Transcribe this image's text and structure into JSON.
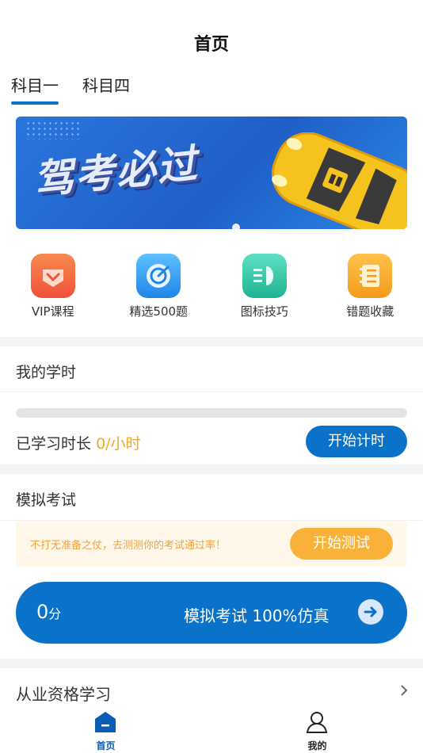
{
  "header": {
    "title": "首页"
  },
  "tabs": [
    {
      "label": "科目一",
      "active": true
    },
    {
      "label": "科目四",
      "active": false
    }
  ],
  "banner": {
    "slogan": "驾考必过"
  },
  "quick_actions": [
    {
      "label": "VIP课程",
      "icon": "vip-heart-icon",
      "color": "#f4683c"
    },
    {
      "label": "精选500题",
      "icon": "target-icon",
      "color": "#2a9bf0"
    },
    {
      "label": "图标技巧",
      "icon": "headlight-icon",
      "color": "#2ec5a6"
    },
    {
      "label": "错题收藏",
      "icon": "notebook-icon",
      "color": "#f6a42c"
    }
  ],
  "study": {
    "title": "我的学时",
    "progress": 0,
    "time_label": "已学习时长",
    "time_value": "0/小时",
    "button": "开始计时"
  },
  "exam": {
    "title": "模拟考试",
    "notice": "不打无准备之仗，去测测你的考试通过率！",
    "test_button": "开始测试",
    "score": "0",
    "score_unit": "分",
    "card_label": "模拟考试 100%仿真"
  },
  "qualification": {
    "label": "从业资格学习"
  },
  "tabbar": [
    {
      "label": "首页",
      "icon": "home-icon",
      "active": true
    },
    {
      "label": "我的",
      "icon": "user-icon",
      "active": false
    }
  ],
  "colors": {
    "primary": "#0a73c9",
    "accent": "#f5a623"
  }
}
